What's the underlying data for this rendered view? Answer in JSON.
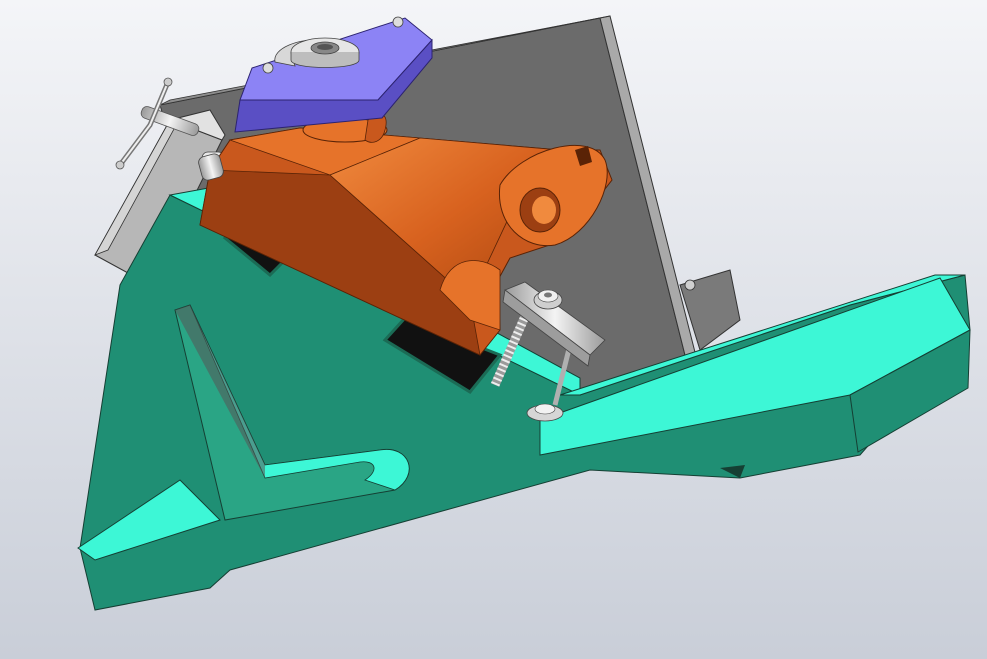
{
  "scene": {
    "background": [
      "#f4f5f8",
      "#c9ced8"
    ],
    "colors": {
      "base_top": "#3df7d6",
      "base_side": "#1f8f74",
      "base_inner": "#2aa585",
      "plate_face": "#6b6b6b",
      "plate_edge": "#a9a9a9",
      "part_light": "#e6732a",
      "part_mid": "#c9581d",
      "part_dark": "#9c3f12",
      "cover_top": "#8c83f5",
      "cover_side": "#5a4fc4",
      "steel_light": "#f1f1f1",
      "steel_mid": "#c7c7c7",
      "steel_dark": "#8c8c8c",
      "pad": "#111111"
    },
    "components": [
      {
        "name": "angle-base",
        "icon": "base-plate-icon"
      },
      {
        "name": "vertical-plate",
        "icon": "plate-icon"
      },
      {
        "name": "workpiece",
        "icon": "lever-icon"
      },
      {
        "name": "cover-plate",
        "icon": "cover-icon"
      },
      {
        "name": "clamp-screw",
        "icon": "screw-icon"
      },
      {
        "name": "clamp-bar",
        "icon": "bar-icon"
      },
      {
        "name": "side-clamp",
        "icon": "t-handle-icon"
      }
    ]
  }
}
